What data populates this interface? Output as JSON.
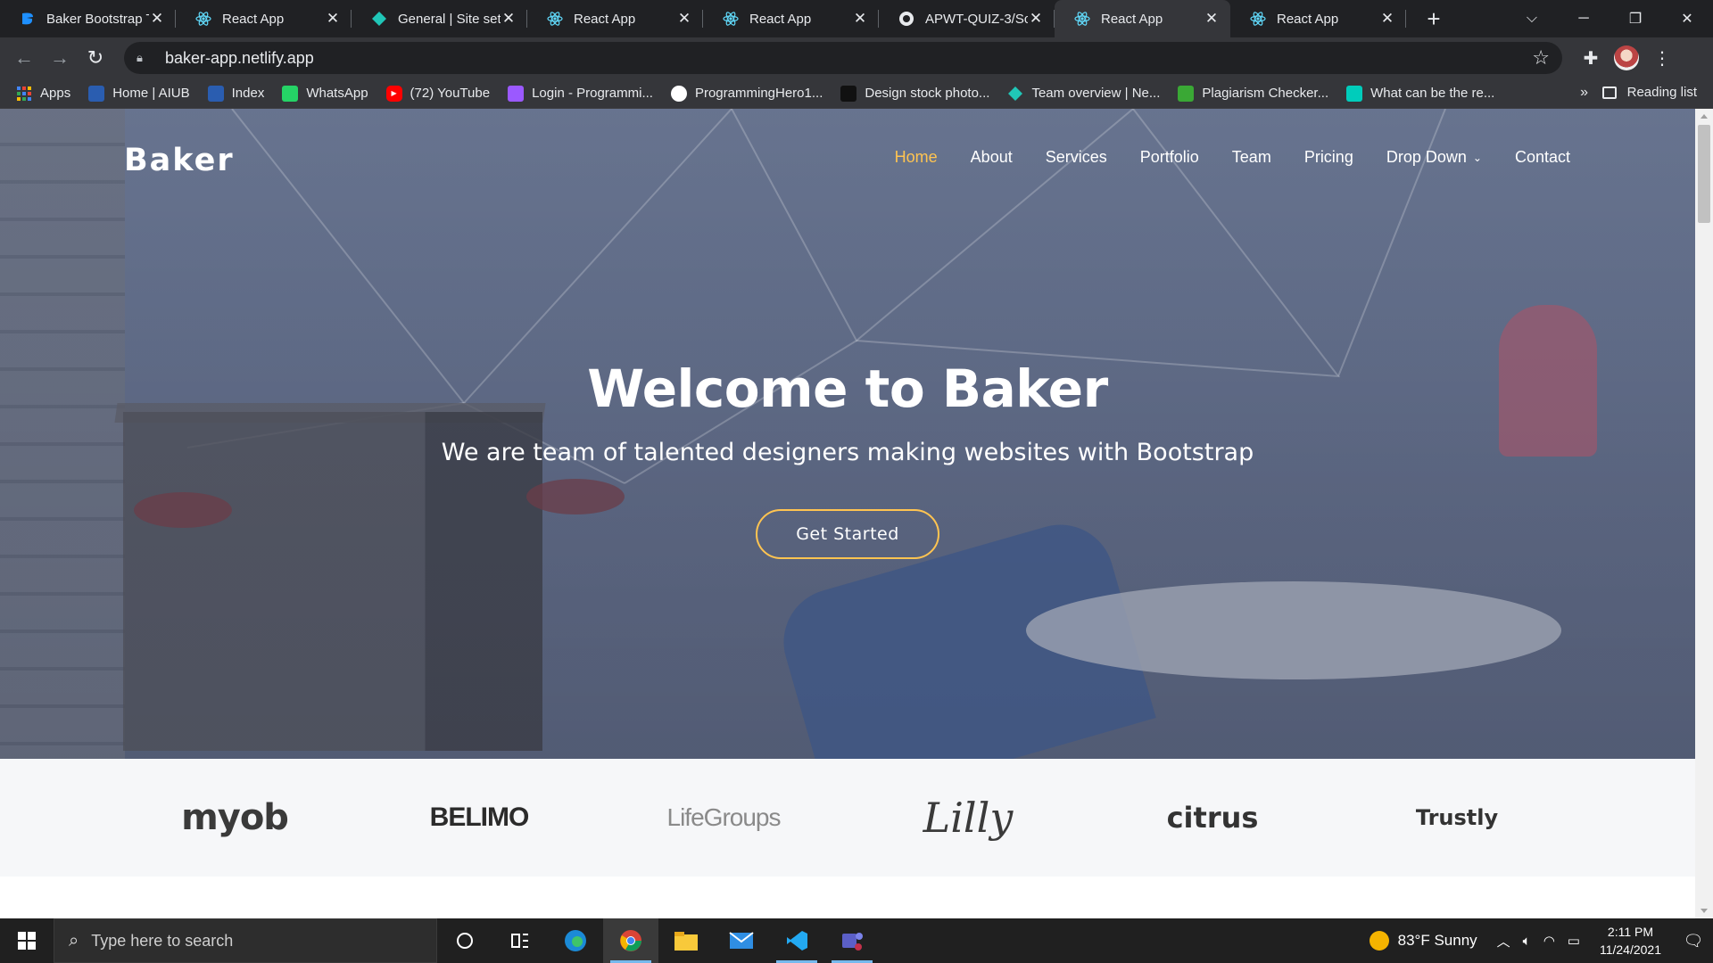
{
  "browser": {
    "tabs": [
      {
        "title": "Baker Bootstrap T",
        "icon": "bootstrapmade-icon",
        "active": false
      },
      {
        "title": "React App",
        "icon": "react-icon",
        "active": false
      },
      {
        "title": "General | Site sett",
        "icon": "netlify-icon",
        "active": false
      },
      {
        "title": "React App",
        "icon": "react-icon",
        "active": false
      },
      {
        "title": "React App",
        "icon": "react-icon",
        "active": false
      },
      {
        "title": "APWT-QUIZ-3/Sc",
        "icon": "github-icon",
        "active": false
      },
      {
        "title": "React App",
        "icon": "react-icon",
        "active": true
      },
      {
        "title": "React App",
        "icon": "react-icon",
        "active": false
      }
    ],
    "new_tab": "+",
    "url": "baker-app.netlify.app",
    "bookmarks": [
      {
        "label": "Apps",
        "icon": "apps-grid-icon",
        "color": "#4285f4"
      },
      {
        "label": "Home | AIUB",
        "icon": "aiub-icon",
        "color": "#2a5db0"
      },
      {
        "label": "Index",
        "icon": "aiub-icon",
        "color": "#2a5db0"
      },
      {
        "label": "WhatsApp",
        "icon": "whatsapp-icon",
        "color": "#25d366"
      },
      {
        "label": "(72) YouTube",
        "icon": "youtube-icon",
        "color": "#ff0000"
      },
      {
        "label": "Login - Programmi...",
        "icon": "programming-hero-icon",
        "color": "#9b59ff"
      },
      {
        "label": "ProgrammingHero1...",
        "icon": "github-icon",
        "color": "#ffffff"
      },
      {
        "label": "Design stock photo...",
        "icon": "shutterstock-icon",
        "color": "#111111"
      },
      {
        "label": "Team overview | Ne...",
        "icon": "netlify-icon",
        "color": "#20c6b7"
      },
      {
        "label": "Plagiarism Checker...",
        "icon": "plagiarism-icon",
        "color": "#3aa835"
      },
      {
        "label": "What can be the re...",
        "icon": "researchgate-icon",
        "color": "#00ccbb"
      }
    ],
    "bookmarks_more": "»",
    "reading_list": "Reading list"
  },
  "site": {
    "brand": "Baker",
    "nav": [
      {
        "label": "Home",
        "active": true
      },
      {
        "label": "About",
        "active": false
      },
      {
        "label": "Services",
        "active": false
      },
      {
        "label": "Portfolio",
        "active": false
      },
      {
        "label": "Team",
        "active": false
      },
      {
        "label": "Pricing",
        "active": false
      },
      {
        "label": "Drop Down",
        "active": false,
        "dropdown": true
      },
      {
        "label": "Contact",
        "active": false
      }
    ],
    "hero": {
      "title": "Welcome to Baker",
      "subtitle": "We are team of talented designers making websites with Bootstrap",
      "cta": "Get Started"
    },
    "clients": [
      "myob",
      "BELIMO",
      "LifeGroups",
      "Lilly",
      "citrus",
      "Trustly"
    ],
    "accent_color": "#ffc451"
  },
  "taskbar": {
    "search_placeholder": "Type here to search",
    "weather": "83°F  Sunny",
    "time": "2:11 PM",
    "date": "11/24/2021"
  }
}
